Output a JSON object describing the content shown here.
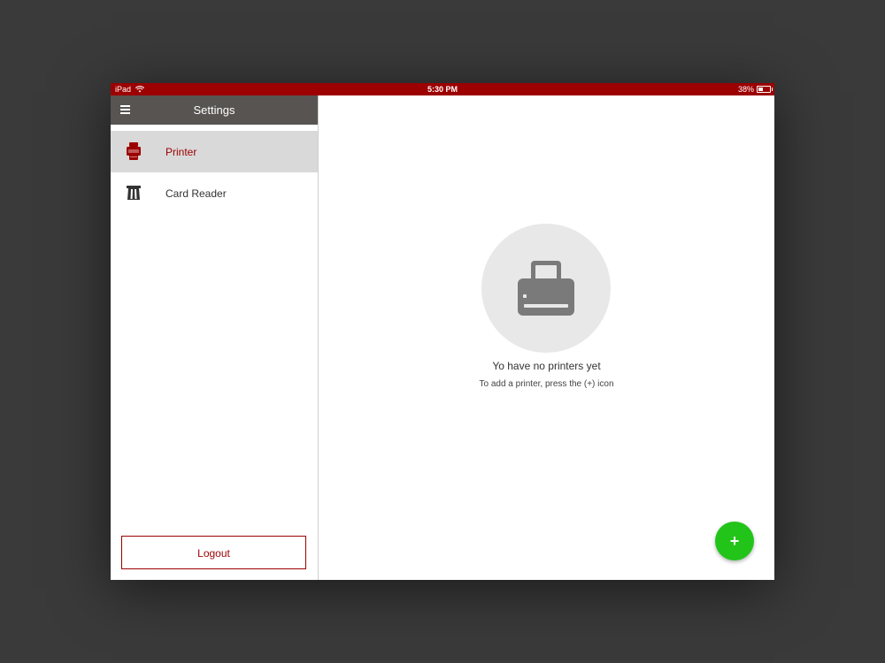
{
  "status_bar": {
    "device": "iPad",
    "time": "5:30 PM",
    "battery": "38%",
    "battery_level": 0.38
  },
  "sidebar": {
    "title": "Settings",
    "items": [
      {
        "label": "Printer",
        "icon": "printer-icon",
        "active": true
      },
      {
        "label": "Card Reader",
        "icon": "card-reader-icon",
        "active": false
      }
    ],
    "logout_label": "Logout"
  },
  "main": {
    "empty_icon": "printer-icon",
    "empty_title": "Yo have no printers yet",
    "empty_subtitle": "To add a printer, press the (+) icon",
    "fab_label": "+"
  },
  "colors": {
    "brand_red": "#9c0000",
    "header_gray": "#575452",
    "active_item": "#d9d9d9",
    "fab_green": "#22c41a",
    "empty_circle": "#e8e8e8",
    "icon_gray": "#7a7a7a"
  }
}
